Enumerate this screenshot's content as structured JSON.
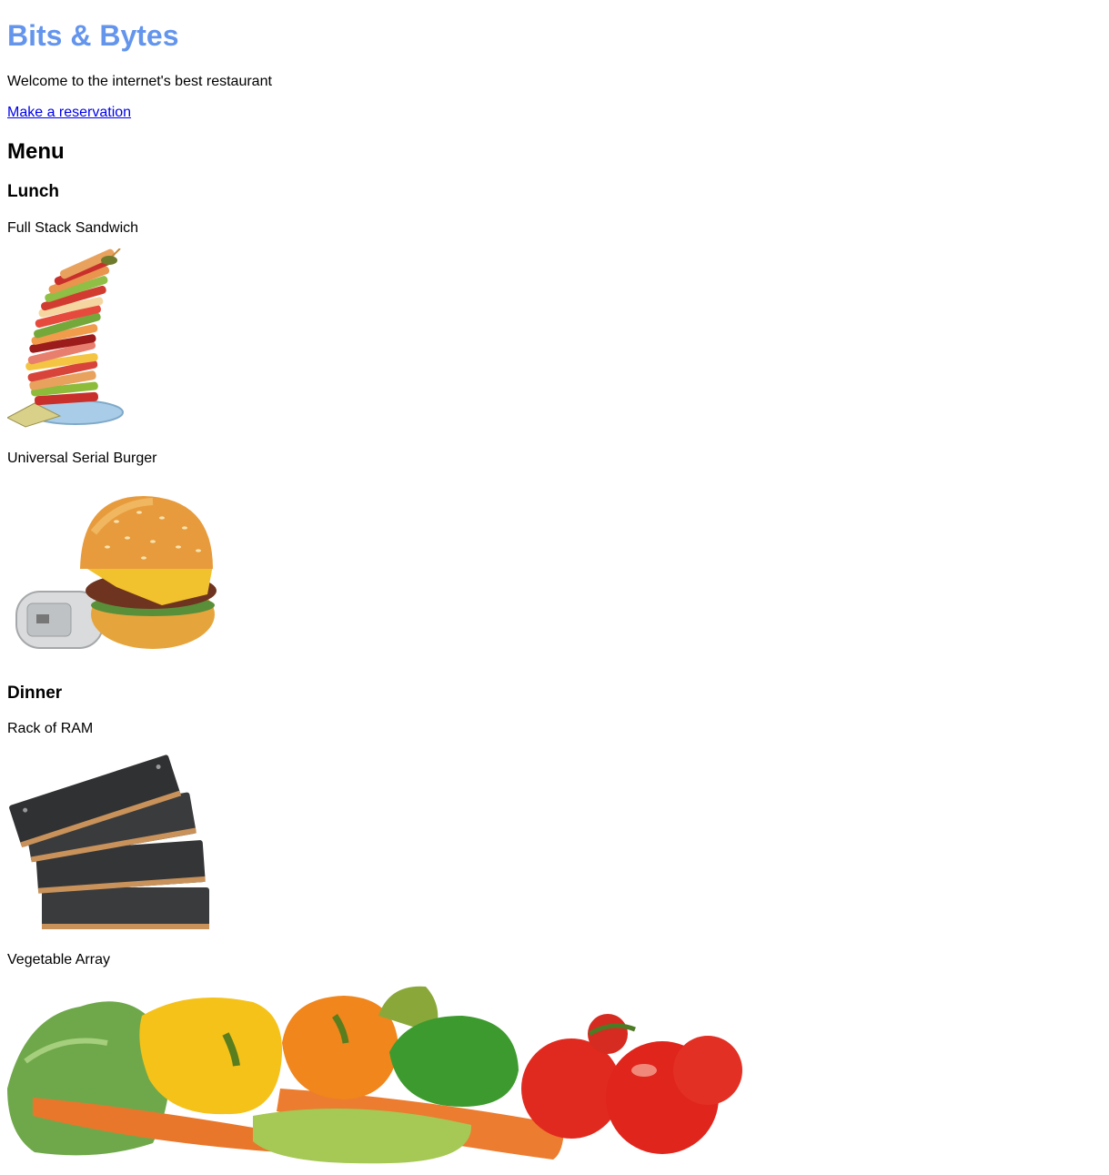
{
  "header": {
    "title": "Bits & Bytes",
    "tagline": "Welcome to the internet's best restaurant",
    "reservation_link": "Make a reservation"
  },
  "menu": {
    "heading": "Menu",
    "sections": [
      {
        "heading": "Lunch",
        "items": [
          {
            "name": "Full Stack Sandwich",
            "image": "stacked-sandwich-image"
          },
          {
            "name": "Universal Serial Burger",
            "image": "usb-burger-image"
          }
        ]
      },
      {
        "heading": "Dinner",
        "items": [
          {
            "name": "Rack of RAM",
            "image": "ram-sticks-image"
          },
          {
            "name": "Vegetable Array",
            "image": "vegetables-image"
          }
        ]
      }
    ]
  },
  "colors": {
    "title": "#6495ed",
    "link": "#0000ee",
    "text": "#000000",
    "background": "#ffffff"
  }
}
